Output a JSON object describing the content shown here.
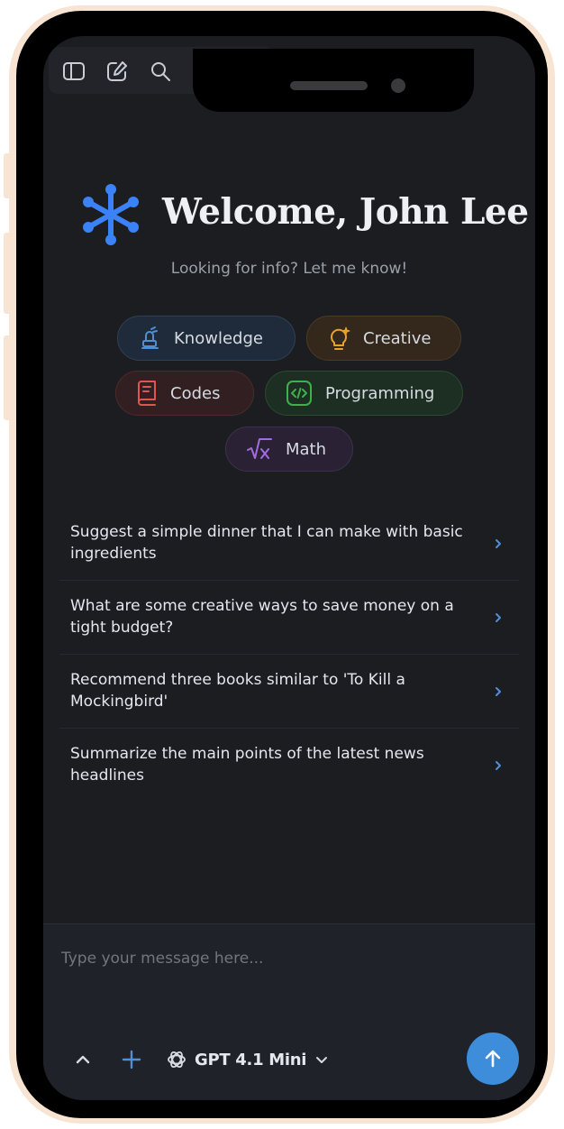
{
  "colors": {
    "background": "#1c1d21",
    "accent": "#3d8ddb",
    "logo": "#3b82f6",
    "knowledge": "#4f8fd6",
    "creative": "#e8a12d",
    "codes": "#e0554f",
    "programming": "#3fb04c",
    "math": "#a36be0"
  },
  "toolbar": {
    "icons": [
      "sidebar-icon",
      "new-chat-icon",
      "search-icon",
      "history-icon",
      "avatar"
    ]
  },
  "hero": {
    "title": "Welcome, John Lee",
    "subtitle": "Looking for info? Let me know!"
  },
  "categories": [
    {
      "label": "Knowledge",
      "icon": "book-lamp-icon"
    },
    {
      "label": "Creative",
      "icon": "lightbulb-icon"
    },
    {
      "label": "Codes",
      "icon": "book-icon"
    },
    {
      "label": "Programming",
      "icon": "code-icon"
    },
    {
      "label": "Math",
      "icon": "square-root-icon"
    }
  ],
  "suggestions": [
    {
      "text": "Suggest a simple dinner that I can make with basic ingredients"
    },
    {
      "text": "What are some creative ways to save money on a tight budget?"
    },
    {
      "text": "Recommend three books similar to 'To Kill a Mockingbird'"
    },
    {
      "text": "Summarize the main points of the latest news headlines"
    }
  ],
  "composer": {
    "placeholder": "Type your message here...",
    "value": "",
    "model": "GPT 4.1 Mini"
  }
}
